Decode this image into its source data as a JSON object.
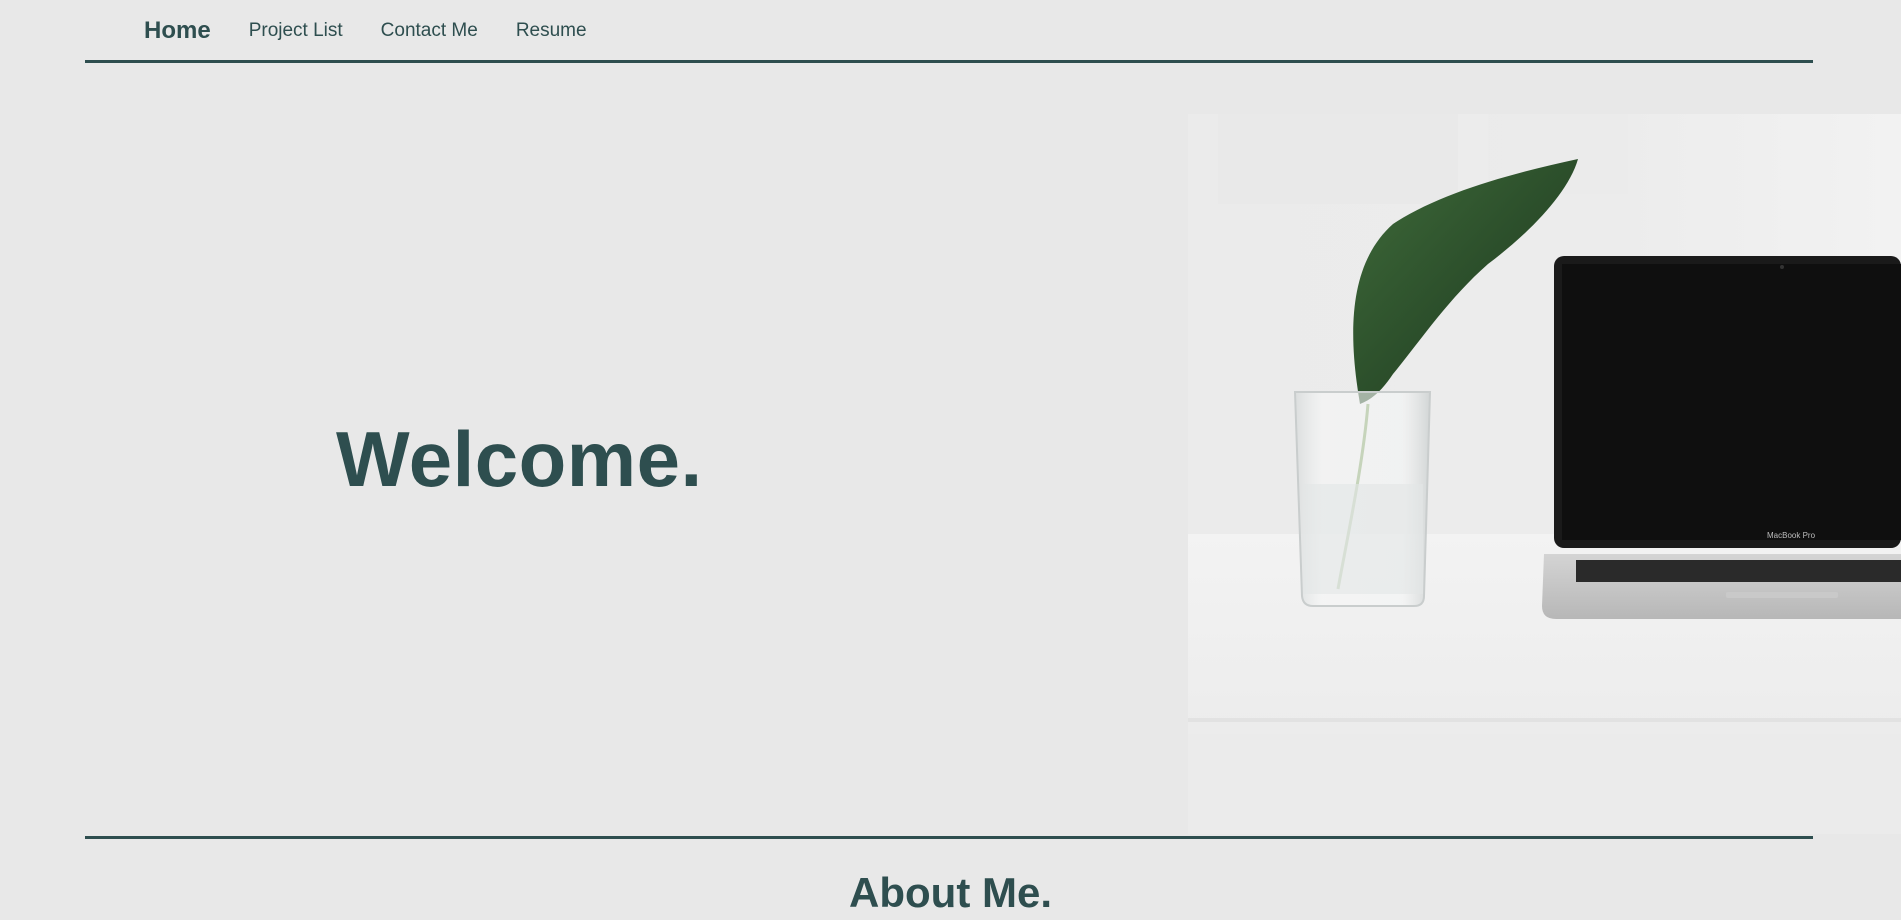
{
  "nav": {
    "items": [
      {
        "label": "Home"
      },
      {
        "label": "Project List"
      },
      {
        "label": "Contact Me"
      },
      {
        "label": "Resume"
      }
    ]
  },
  "hero": {
    "title": "Welcome.",
    "laptop_brand_text": "MacBook Pro"
  },
  "about": {
    "title": "About Me."
  },
  "colors": {
    "background": "#e8e8e8",
    "accent": "#2e4e4f",
    "rule": "#2e4e4f"
  },
  "icons": {
    "hero_image": "desk-plant-laptop-photo"
  }
}
